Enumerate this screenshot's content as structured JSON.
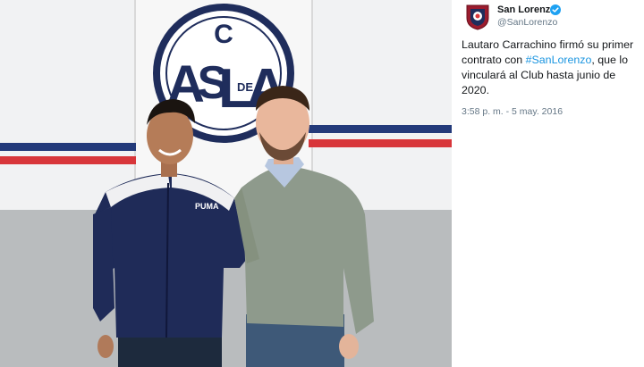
{
  "tweet": {
    "author_name": "San Lorenzo",
    "handle": "@SanLorenzo",
    "text_before": "Lautaro Carrachino firmó su primer contrato con ",
    "hashtag": "#SanLorenzo",
    "text_after": ", que lo vinculará al Club hasta junio de 2020.",
    "timestamp": "3:58 p. m. - 5 may. 2016"
  },
  "photo": {
    "crest_letters": [
      "C",
      "A",
      "S",
      "L",
      "DE",
      "A"
    ],
    "jacket_brand": "PUMA"
  },
  "colors": {
    "club_blue": "#233a7a",
    "club_red": "#d8363a",
    "hashtag": "#1b95e0",
    "verified": "#1da1f2"
  },
  "icons": {
    "avatar": "club-crest-icon",
    "verified": "verified-badge-icon"
  }
}
